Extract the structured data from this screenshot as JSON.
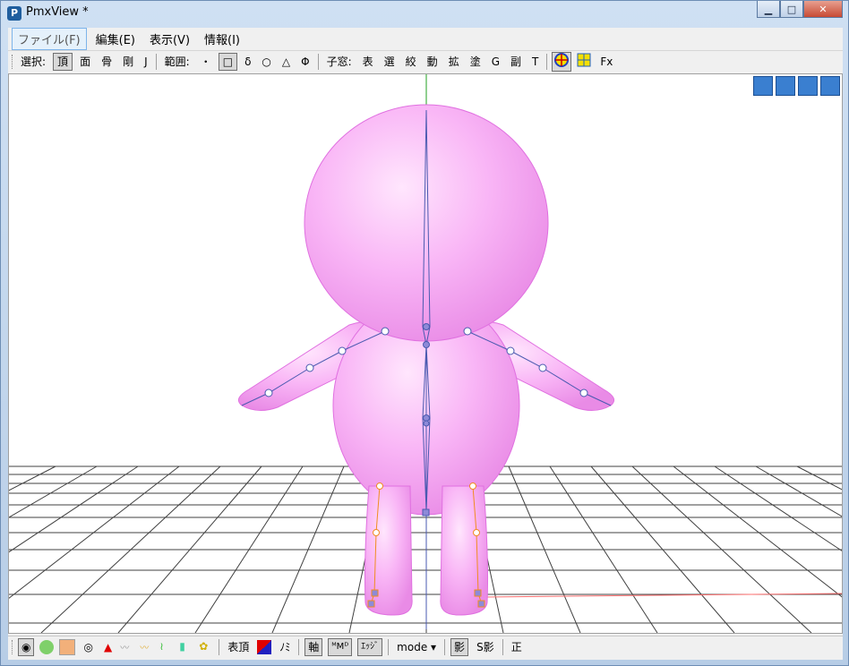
{
  "window": {
    "title": "PmxView *"
  },
  "menu": [
    {
      "label": "ファイル(F)"
    },
    {
      "label": "編集(E)"
    },
    {
      "label": "表示(V)"
    },
    {
      "label": "情報(I)"
    }
  ],
  "toolbar": {
    "select_label": "選択:",
    "select_items": [
      "頂",
      "面",
      "骨",
      "剛",
      "J"
    ],
    "range_label": "範囲:",
    "range_items": [
      "・",
      "□",
      "δ",
      "○",
      "△",
      "Φ"
    ],
    "child_label": "子窓:",
    "child_items": [
      "表",
      "選",
      "絞",
      "動",
      "拡",
      "塗",
      "G",
      "副",
      "T"
    ],
    "fx_label": "Fx"
  },
  "statusbar": {
    "vertex_label": "表頂",
    "mi_label": "ﾉﾐ",
    "axis_label": "軸",
    "md_label": "ᴹMᴰ",
    "edge_label": "ｴｯｼﾞ",
    "mode_label": "mode ▾",
    "shadow_label": "影",
    "sshadow_label": "S影",
    "ortho_label": "正"
  },
  "colors": {
    "model_pink": "#f7a6f3",
    "bone_blue": "#4a5ab0",
    "bone_orange": "#f08c20"
  }
}
